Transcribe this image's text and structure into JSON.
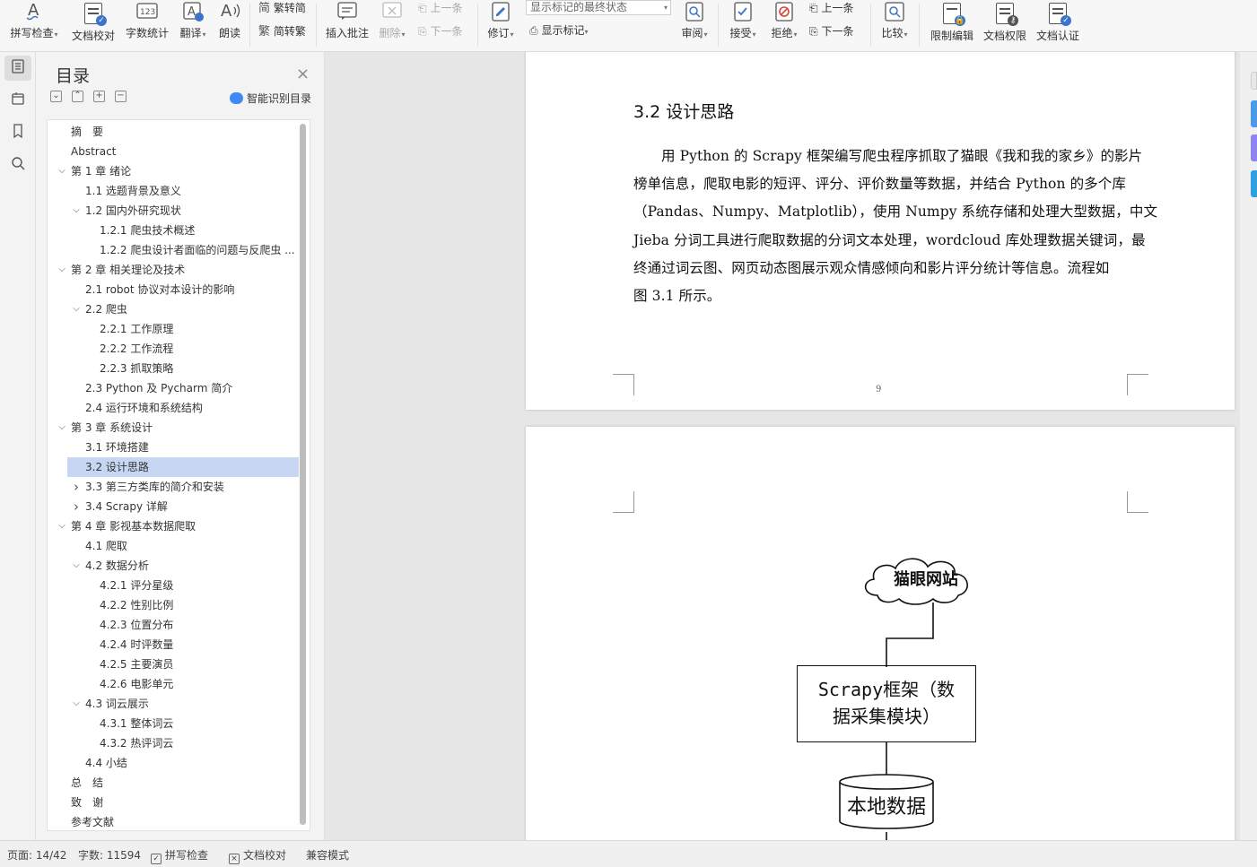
{
  "ribbon": {
    "spell_check": "拼写检查",
    "doc_proof": "文档校对",
    "word_count": "字数统计",
    "translate": "翻译",
    "read_aloud": "朗读",
    "trad_to_simp": "繁转简",
    "simp_to_trad": "简转繁",
    "insert_comment": "插入批注",
    "delete": "删除",
    "prev_comment": "上一条",
    "next_comment": "下一条",
    "track_changes": "修订",
    "markup_state": "显示标记的最终状态",
    "show_markup": "显示标记",
    "review": "审阅",
    "accept": "接受",
    "reject": "拒绝",
    "prev_change": "上一条",
    "next_change": "下一条",
    "compare": "比较",
    "restrict_edit": "限制编辑",
    "doc_permission": "文档权限",
    "doc_auth": "文档认证"
  },
  "toc": {
    "title": "目录",
    "smart_toc": "智能识别目录",
    "items": [
      {
        "label": "摘　要",
        "level": 1,
        "toggle": ""
      },
      {
        "label": "Abstract",
        "level": 1,
        "toggle": ""
      },
      {
        "label": "第 1 章  绪论",
        "level": 1,
        "toggle": "open"
      },
      {
        "label": "1.1  选题背景及意义",
        "level": 2,
        "toggle": ""
      },
      {
        "label": "1.2  国内外研究现状",
        "level": 2,
        "toggle": "open"
      },
      {
        "label": "1.2.1  爬虫技术概述",
        "level": 3,
        "toggle": ""
      },
      {
        "label": "1.2.2  爬虫设计者面临的问题与反爬虫 ...",
        "level": 3,
        "toggle": ""
      },
      {
        "label": "第 2 章  相关理论及技术",
        "level": 1,
        "toggle": "open"
      },
      {
        "label": "2.1 robot 协议对本设计的影响",
        "level": 2,
        "toggle": ""
      },
      {
        "label": "2.2  爬虫",
        "level": 2,
        "toggle": "open"
      },
      {
        "label": "2.2.1  工作原理",
        "level": 3,
        "toggle": ""
      },
      {
        "label": "2.2.2  工作流程",
        "level": 3,
        "toggle": ""
      },
      {
        "label": "2.2.3  抓取策略",
        "level": 3,
        "toggle": ""
      },
      {
        "label": "2.3 Python 及 Pycharm 简介",
        "level": 2,
        "toggle": ""
      },
      {
        "label": "2.4 运行环境和系统结构",
        "level": 2,
        "toggle": ""
      },
      {
        "label": "第 3 章  系统设计",
        "level": 1,
        "toggle": "open"
      },
      {
        "label": "3.1 环境搭建",
        "level": 2,
        "toggle": ""
      },
      {
        "label": "3.2 设计思路",
        "level": 2,
        "toggle": "",
        "selected": true
      },
      {
        "label": "3.3  第三方类库的简介和安装",
        "level": 2,
        "toggle": "closed"
      },
      {
        "label": "3.4 Scrapy 详解",
        "level": 2,
        "toggle": "closed"
      },
      {
        "label": "第 4 章  影视基本数据爬取",
        "level": 1,
        "toggle": "open"
      },
      {
        "label": "4.1 爬取",
        "level": 2,
        "toggle": ""
      },
      {
        "label": "4.2 数据分析",
        "level": 2,
        "toggle": "open"
      },
      {
        "label": "4.2.1 评分星级",
        "level": 3,
        "toggle": ""
      },
      {
        "label": "4.2.2 性别比例",
        "level": 3,
        "toggle": ""
      },
      {
        "label": "4.2.3 位置分布",
        "level": 3,
        "toggle": ""
      },
      {
        "label": "4.2.4 时评数量",
        "level": 3,
        "toggle": ""
      },
      {
        "label": "4.2.5 主要演员",
        "level": 3,
        "toggle": ""
      },
      {
        "label": "4.2.6 电影单元",
        "level": 3,
        "toggle": ""
      },
      {
        "label": "4.3 词云展示",
        "level": 2,
        "toggle": "open"
      },
      {
        "label": "4.3.1 整体词云",
        "level": 3,
        "toggle": ""
      },
      {
        "label": "4.3.2 热评词云",
        "level": 3,
        "toggle": ""
      },
      {
        "label": "4.4 小结",
        "level": 2,
        "toggle": ""
      },
      {
        "label": "总　结",
        "level": 1,
        "toggle": ""
      },
      {
        "label": "致　谢",
        "level": 1,
        "toggle": ""
      },
      {
        "label": "参考文献",
        "level": 1,
        "toggle": ""
      }
    ]
  },
  "document": {
    "heading": "3.2 设计思路",
    "lines": [
      "用 Python 的 Scrapy 框架编写爬虫程序抓取了猫眼《我和我的家乡》的影片",
      "榜单信息，爬取电影的短评、评分、评价数量等数据，并结合 Python 的多个库",
      "（Pandas、Numpy、Matplotlib），使用 Numpy 系统存储和处理大型数据，中文",
      "Jieba 分词工具进行爬取数据的分词文本处理，wordcloud 库处理数据关键词，最",
      "终通过词云图、网页动态图展示观众情感倾向和影片评分统计等信息。流程如",
      "图 3.1 所示。"
    ],
    "page_number": "9",
    "diagram": {
      "cloud_label": "猫眼网站",
      "box_label_1": "Scrapy框架（数",
      "box_label_2": "据采集模块）",
      "db_label": "本地数据"
    }
  },
  "status": {
    "page": "页面: 14/42",
    "words": "字数: 11594",
    "spell_check": "拼写检查",
    "doc_proof": "文档校对",
    "compat_mode": "兼容模式"
  },
  "colors": {
    "accent": "#3f88f5",
    "selection": "#c7d7f3",
    "reject_red": "#d9453a",
    "side_tab_blue": "#4b9ae8",
    "side_tab_purple": "#8e84f0"
  }
}
